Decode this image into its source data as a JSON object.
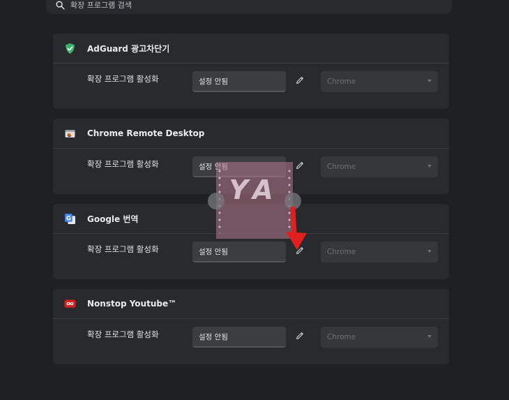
{
  "search": {
    "placeholder": "확장 프로그램 검색"
  },
  "colors": {
    "adguard_green": "#3bb26a",
    "arrow_red": "#e21f1f",
    "youtube_red": "#d32020"
  },
  "extensions": [
    {
      "name": "AdGuard 광고차단기",
      "icon": "shield-check-icon",
      "row_label": "확장 프로그램 활성화",
      "shortcut": "설정 안됨",
      "scope": "Chrome"
    },
    {
      "name": "Chrome Remote Desktop",
      "icon": "remote-desktop-icon",
      "row_label": "확장 프로그램 활성화",
      "shortcut": "설정 안됨",
      "scope": "Chrome"
    },
    {
      "name": "Google 번역",
      "icon": "google-translate-icon",
      "row_label": "확장 프로그램 활성화",
      "shortcut": "설정 안됨",
      "scope": "Chrome"
    },
    {
      "name": "Nonstop Youtube™",
      "icon": "nonstop-youtube-icon",
      "row_label": "확장 프로그램 활성화",
      "shortcut": "설정 안됨",
      "scope": "Chrome"
    }
  ],
  "watermark": {
    "text": "YA"
  }
}
